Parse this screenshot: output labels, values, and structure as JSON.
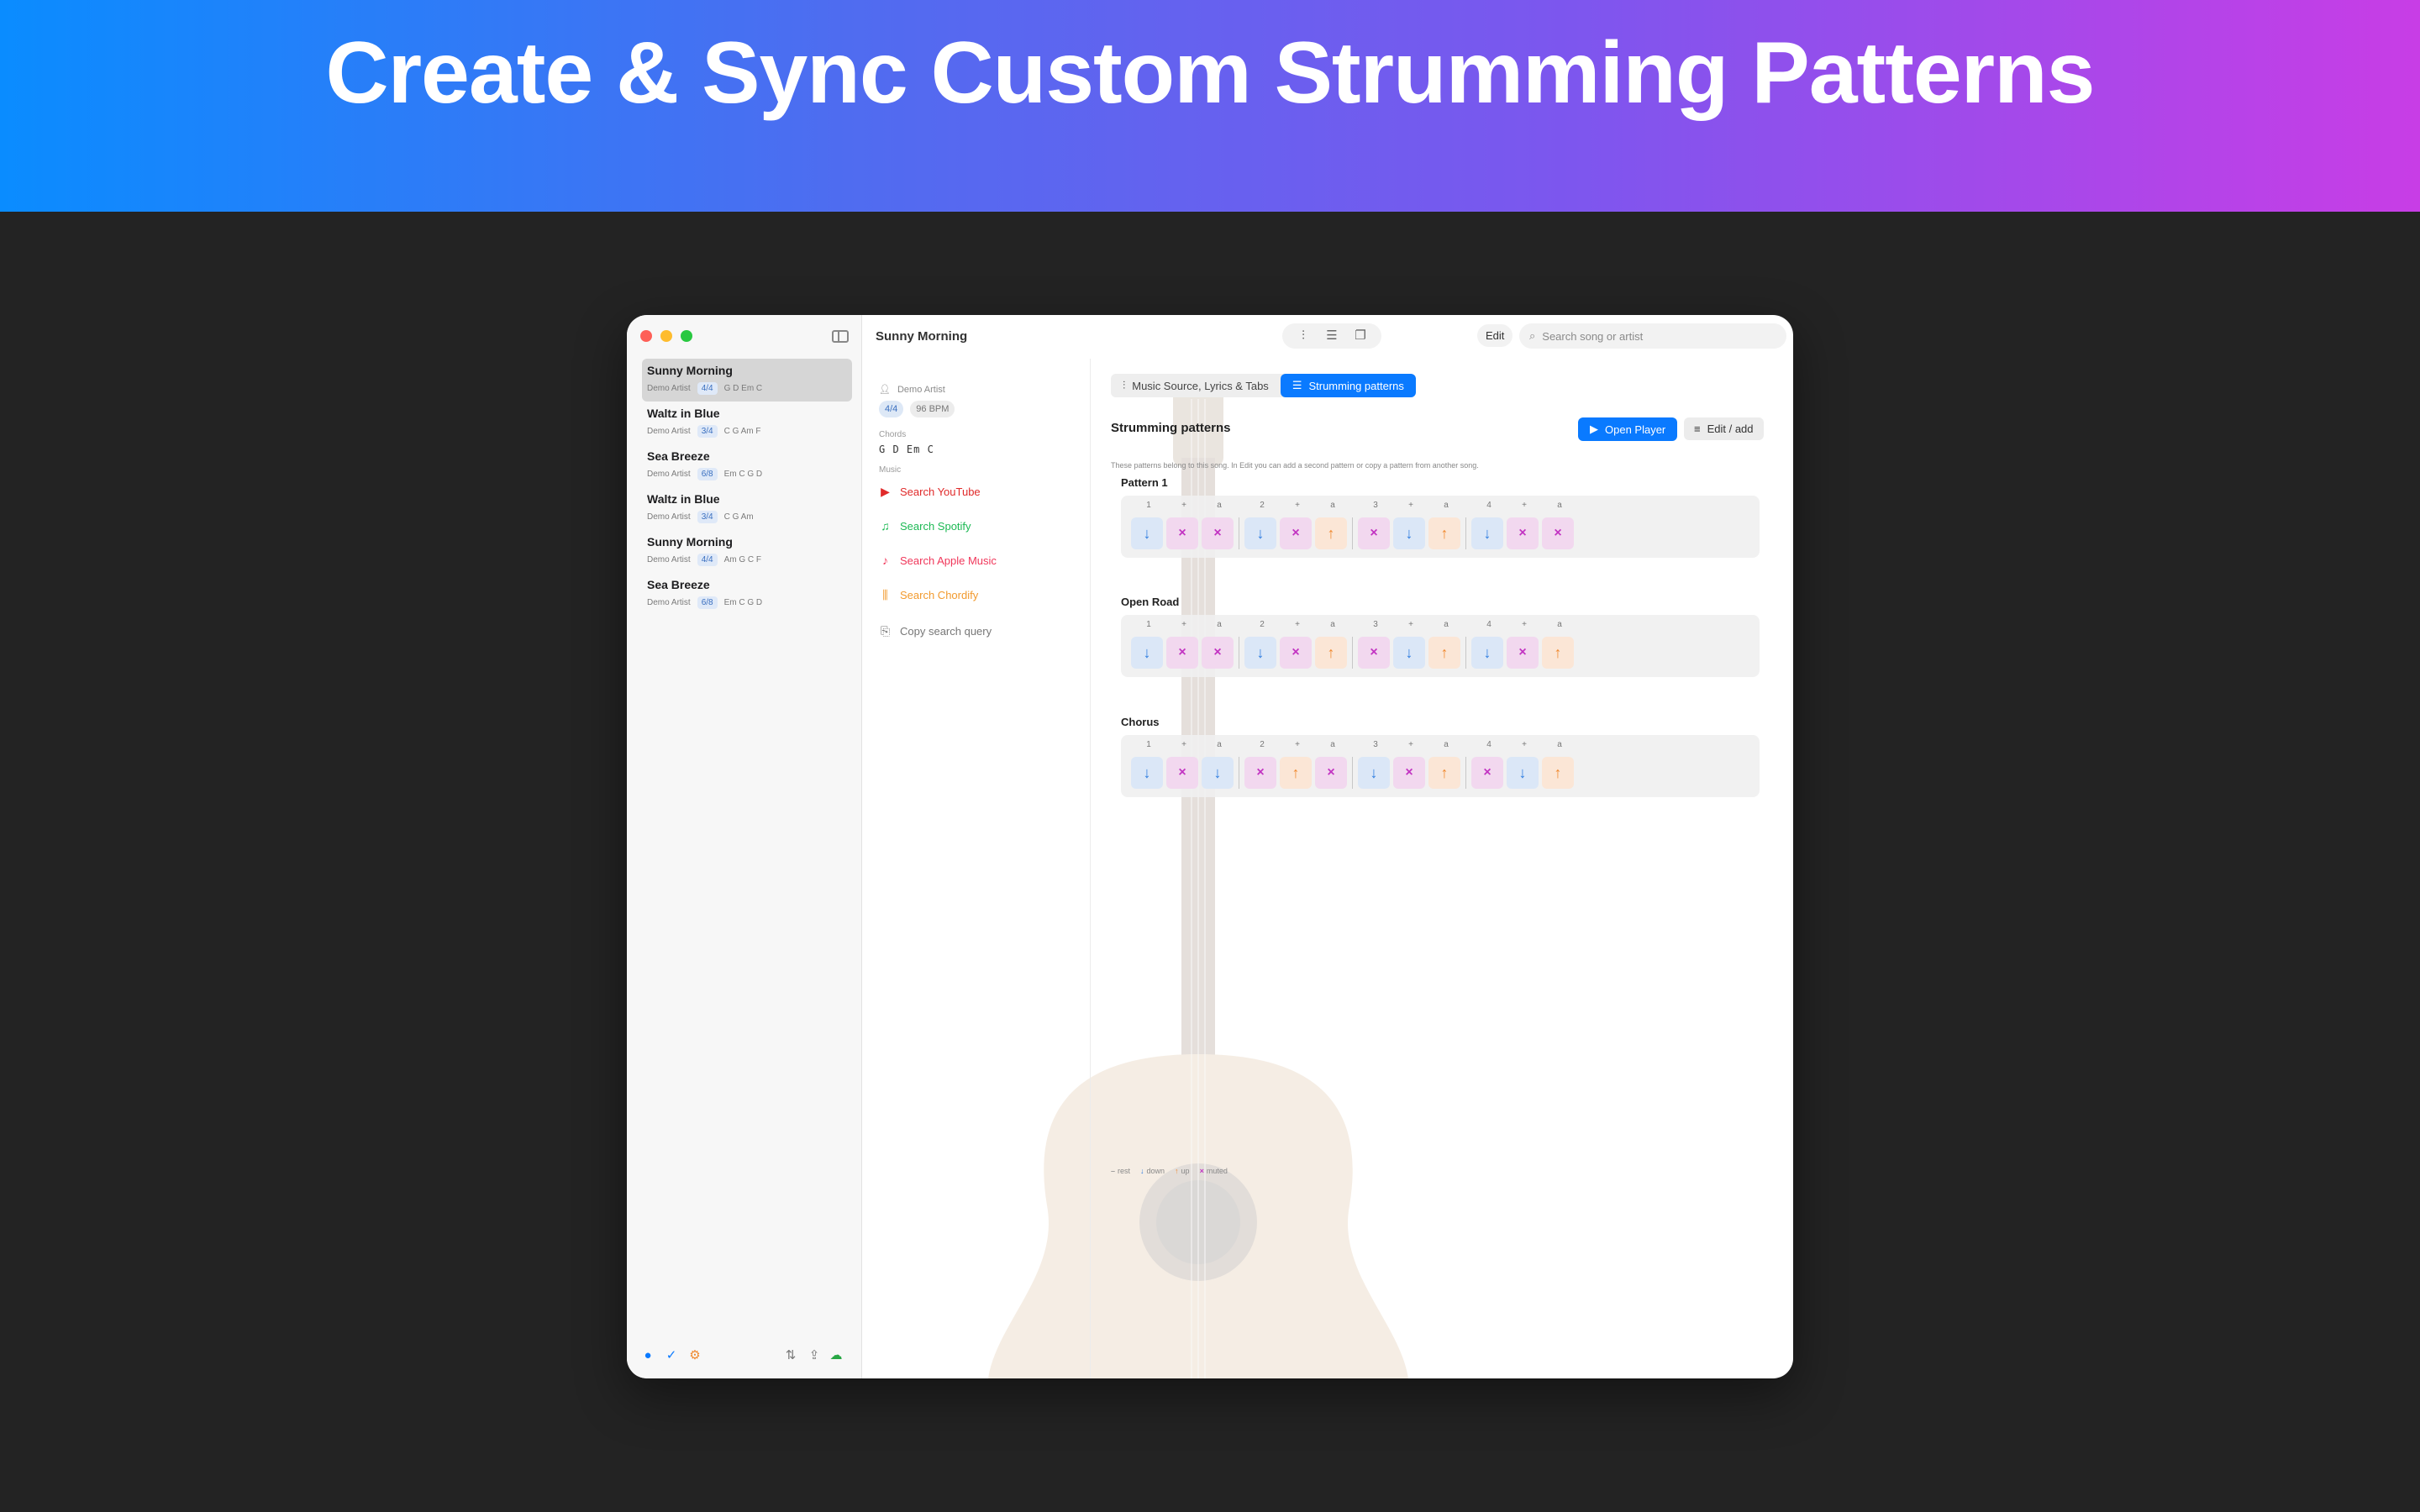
{
  "banner": {
    "title": "Create & Sync Custom Strumming Patterns"
  },
  "window": {
    "title": "Sunny Morning"
  },
  "sidebar": {
    "songs": [
      {
        "title": "Sunny Morning",
        "artist": "Demo Artist",
        "time_signature": "4/4",
        "chords": "G D Em C",
        "active": true
      },
      {
        "title": "Waltz in Blue",
        "artist": "Demo Artist",
        "time_signature": "3/4",
        "chords": "C G Am F",
        "active": false
      },
      {
        "title": "Sea Breeze",
        "artist": "Demo Artist",
        "time_signature": "6/8",
        "chords": "Em C G D",
        "active": false
      },
      {
        "title": "Waltz in Blue",
        "artist": "Demo Artist",
        "time_signature": "3/4",
        "chords": "C G Am",
        "active": false
      },
      {
        "title": "Sunny Morning",
        "artist": "Demo Artist",
        "time_signature": "4/4",
        "chords": "Am G C F",
        "active": false
      },
      {
        "title": "Sea Breeze",
        "artist": "Demo Artist",
        "time_signature": "6/8",
        "chords": "Em C G D",
        "active": false
      }
    ]
  },
  "toolbar": {
    "edit_label": "Edit",
    "search_placeholder": "Search song or artist"
  },
  "info": {
    "artist": "Demo Artist",
    "time_signature": "4/4",
    "bpm": "96 BPM",
    "chords_label": "Chords",
    "chords": "G D Em C",
    "music_label": "Music",
    "links": [
      {
        "label": "Search YouTube",
        "icon": "youtube-icon",
        "color": "#e02a2a"
      },
      {
        "label": "Search Spotify",
        "icon": "spotify-icon",
        "color": "#1db954"
      },
      {
        "label": "Search Apple Music",
        "icon": "music-note-icon",
        "color": "#f0375a"
      },
      {
        "label": "Search Chordify",
        "icon": "chordify-icon",
        "color": "#f29a2e"
      },
      {
        "label": "Copy search query",
        "icon": "copy-icon",
        "color": "#777777"
      }
    ]
  },
  "main": {
    "tabs": [
      {
        "label": "Music Source, Lyrics & Tabs",
        "active": false
      },
      {
        "label": "Strumming patterns",
        "active": true
      }
    ],
    "section_title": "Strumming patterns",
    "open_player_label": "Open Player",
    "edit_add_label": "Edit / add",
    "description": "These patterns belong to this song. In Edit you can add a second pattern or copy a pattern from another song.",
    "beat_labels": [
      "1",
      "+",
      "a",
      "2",
      "+",
      "a",
      "3",
      "+",
      "a",
      "4",
      "+",
      "a"
    ],
    "patterns": [
      {
        "name": "Pattern 1",
        "strokes": [
          "down",
          "muted",
          "muted",
          "down",
          "muted",
          "up",
          "muted",
          "down",
          "up",
          "down",
          "muted",
          "muted"
        ]
      },
      {
        "name": "Open Road",
        "strokes": [
          "down",
          "muted",
          "muted",
          "down",
          "muted",
          "up",
          "muted",
          "down",
          "up",
          "down",
          "muted",
          "up"
        ]
      },
      {
        "name": "Chorus",
        "strokes": [
          "down",
          "muted",
          "down",
          "muted",
          "up",
          "muted",
          "down",
          "muted",
          "up",
          "muted",
          "down",
          "up"
        ]
      }
    ],
    "legend": [
      {
        "symbol": "–",
        "label": "rest",
        "color": "#999999"
      },
      {
        "symbol": "↓",
        "label": "down",
        "color": "#2f7de0"
      },
      {
        "symbol": "↑",
        "label": "up",
        "color": "#f08a30"
      },
      {
        "symbol": "×",
        "label": "muted",
        "color": "#c233c2"
      }
    ]
  }
}
